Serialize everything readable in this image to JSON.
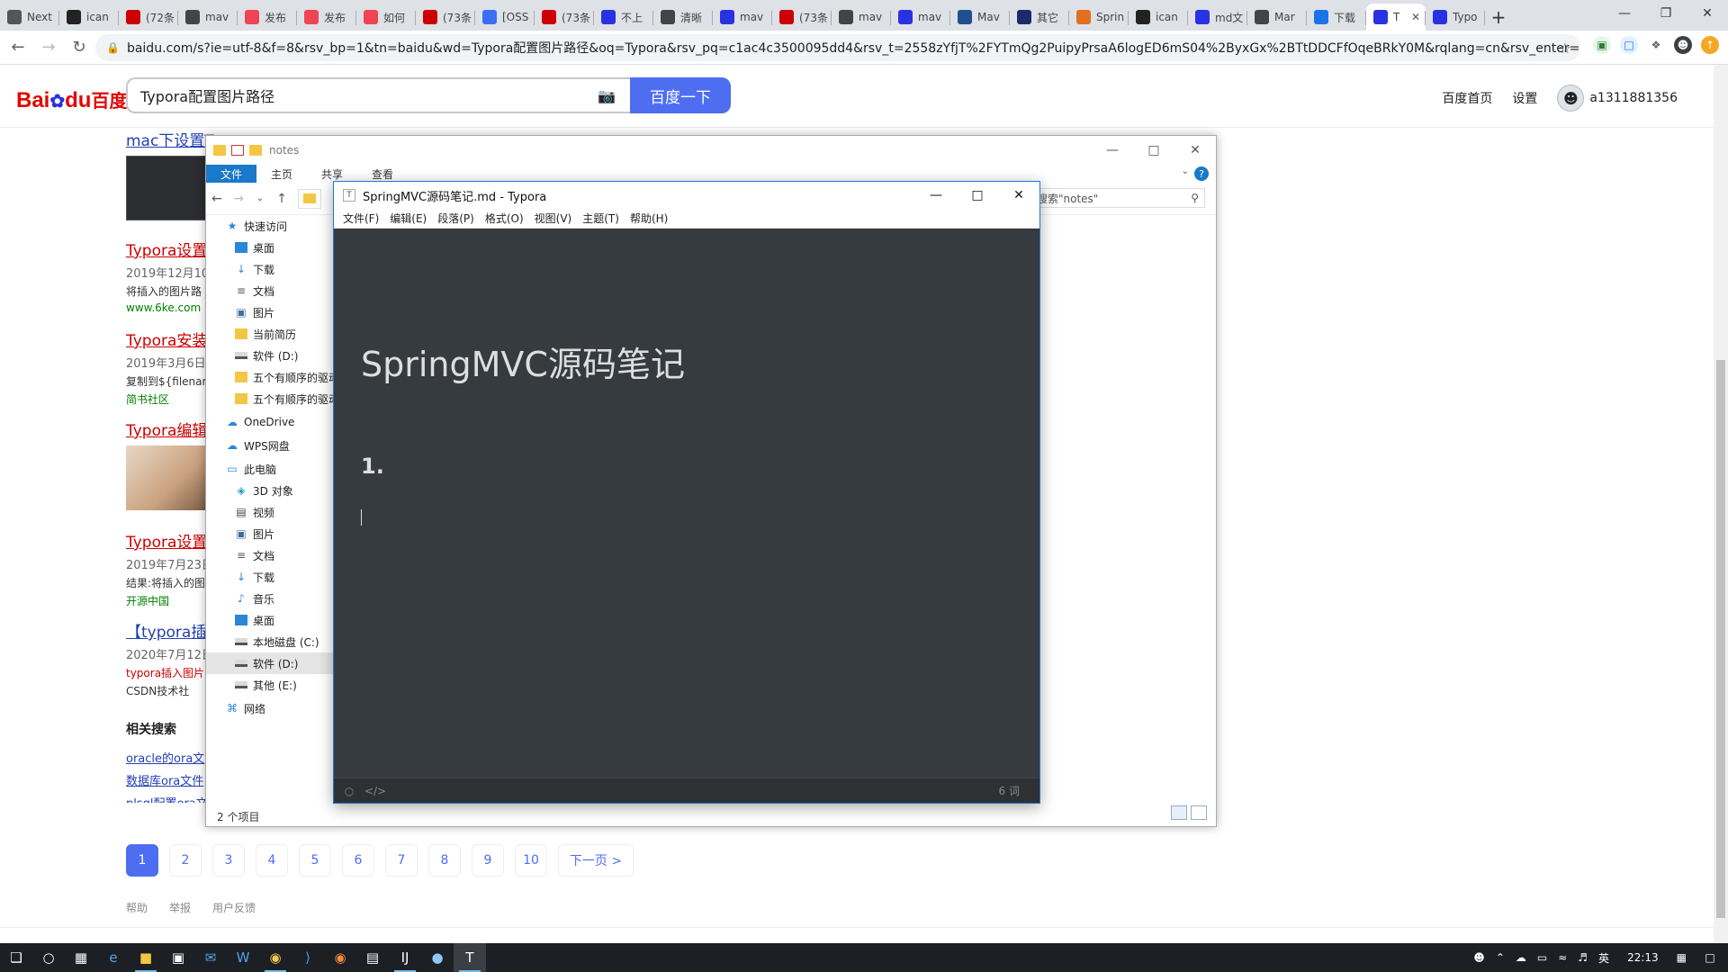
{
  "browser": {
    "tabs": [
      {
        "label": "Next",
        "color": "#555"
      },
      {
        "label": "ican",
        "color": "#222"
      },
      {
        "label": "(72条",
        "color": "#c00"
      },
      {
        "label": "mav",
        "color": "#444"
      },
      {
        "label": "发布",
        "color": "#e45"
      },
      {
        "label": "发布",
        "color": "#e45"
      },
      {
        "label": "如何",
        "color": "#e45"
      },
      {
        "label": "(73条",
        "color": "#c00"
      },
      {
        "label": "[OSS",
        "color": "#3b6ff3"
      },
      {
        "label": "(73条",
        "color": "#c00"
      },
      {
        "label": "不上",
        "color": "#2932e1"
      },
      {
        "label": "清晰",
        "color": "#444"
      },
      {
        "label": "mav",
        "color": "#2932e1"
      },
      {
        "label": "(73条",
        "color": "#c00"
      },
      {
        "label": "mav",
        "color": "#444"
      },
      {
        "label": "mav",
        "color": "#2932e1"
      },
      {
        "label": "Mav",
        "color": "#1f4f8f"
      },
      {
        "label": "其它",
        "color": "#1a2b6d"
      },
      {
        "label": "Sprin",
        "color": "#e36f20"
      },
      {
        "label": "ican",
        "color": "#222"
      },
      {
        "label": "md文",
        "color": "#2932e1"
      },
      {
        "label": "Mar",
        "color": "#444"
      },
      {
        "label": "下载",
        "color": "#1a73e8"
      },
      {
        "label": "T",
        "color": "#2932e1",
        "active": true
      },
      {
        "label": "Typo",
        "color": "#2932e1"
      }
    ],
    "new_tab": "+",
    "url": "baidu.com/s?ie=utf-8&f=8&rsv_bp=1&tn=baidu&wd=Typora配置图片路径&oq=Typora&rsv_pq=c1ac4c3500095dd4&rsv_t=2558zYfjT%2FYTmQg2PuipyPrsaA6logED6mS04%2ByxGx%2BTtDDCFfOqeBRkY0M&rqlang=cn&rsv_enter=..."
  },
  "baidu": {
    "logo_main": "Bai",
    "logo_paw": "du",
    "logo_cn": "百度",
    "query": "Typora配置图片路径",
    "search_button": "百度一下",
    "home_link": "百度首页",
    "settings_link": "设置",
    "username": "a1311881356",
    "results": [
      {
        "title": "mac下设置Typora图片的相对路径 - 简书",
        "type": "image"
      },
      {
        "title": "Typora设置",
        "date": "2019年12月10",
        "text": "将插入的图片路",
        "source": "www.6ke.com"
      },
      {
        "title": "Typora安装",
        "date": "2019年3月6日",
        "text": "复制到${filenar",
        "source": "简书社区"
      },
      {
        "title": "Typora编辑",
        "type": "image"
      },
      {
        "title": "Typora设置",
        "date": "2019年7月23日",
        "text": "结果:将插入的图",
        "source": "开源中国"
      },
      {
        "title": "【typora插入",
        "date": "2020年7月12日",
        "text": "typora插入图片",
        "source": "CSDN技术社"
      }
    ],
    "related_heading": "相关搜索",
    "related": [
      "oracle的ora文",
      "数据库ora文件",
      "plsql配置ora文"
    ],
    "pages": [
      "1",
      "2",
      "3",
      "4",
      "5",
      "6",
      "7",
      "8",
      "9",
      "10"
    ],
    "next_page": "下一页 >",
    "footer": [
      "帮助",
      "举报",
      "用户反馈"
    ]
  },
  "explorer": {
    "title": "notes",
    "ribbon_tabs": [
      "文件",
      "主页",
      "共享",
      "查看"
    ],
    "search_placeholder": "搜索\"notes\"",
    "nav": [
      {
        "label": "快速访问",
        "level": 1,
        "icon": "star-icon"
      },
      {
        "label": "桌面",
        "level": 2,
        "icon": "desktop-icon"
      },
      {
        "label": "下载",
        "level": 2,
        "icon": "download-icon"
      },
      {
        "label": "文档",
        "level": 2,
        "icon": "document-icon"
      },
      {
        "label": "图片",
        "level": 2,
        "icon": "picture-icon"
      },
      {
        "label": "当前简历",
        "level": 2,
        "icon": "folder-icon"
      },
      {
        "label": "软件 (D:)",
        "level": 2,
        "icon": "drive-icon"
      },
      {
        "label": "五个有顺序的驱动",
        "level": 2,
        "icon": "folder-icon"
      },
      {
        "label": "五个有顺序的驱动",
        "level": 2,
        "icon": "folder-icon"
      },
      {
        "label": "OneDrive",
        "level": 1,
        "icon": "cloud-icon"
      },
      {
        "label": "WPS网盘",
        "level": 1,
        "icon": "cloud-icon"
      },
      {
        "label": "此电脑",
        "level": 1,
        "icon": "computer-icon"
      },
      {
        "label": "3D 对象",
        "level": 2,
        "icon": "cube-icon"
      },
      {
        "label": "视频",
        "level": 2,
        "icon": "video-icon"
      },
      {
        "label": "图片",
        "level": 2,
        "icon": "picture-icon"
      },
      {
        "label": "文档",
        "level": 2,
        "icon": "document-icon"
      },
      {
        "label": "下载",
        "level": 2,
        "icon": "download-icon"
      },
      {
        "label": "音乐",
        "level": 2,
        "icon": "music-icon"
      },
      {
        "label": "桌面",
        "level": 2,
        "icon": "desktop-icon"
      },
      {
        "label": "本地磁盘 (C:)",
        "level": 2,
        "icon": "drive-icon"
      },
      {
        "label": "软件 (D:)",
        "level": 2,
        "icon": "drive-icon",
        "selected": true
      },
      {
        "label": "其他 (E:)",
        "level": 2,
        "icon": "drive-icon"
      },
      {
        "label": "网络",
        "level": 1,
        "icon": "network-icon"
      }
    ],
    "status": "2 个项目"
  },
  "typora": {
    "title": "SpringMVC源码笔记.md - Typora",
    "menu": [
      "文件(F)",
      "编辑(E)",
      "段落(P)",
      "格式(O)",
      "视图(V)",
      "主题(T)",
      "帮助(H)"
    ],
    "heading": "SpringMVC源码笔记",
    "list_marker": "1.",
    "word_count": "6 词"
  },
  "taskbar": {
    "time": "22:13",
    "ime": "英"
  }
}
